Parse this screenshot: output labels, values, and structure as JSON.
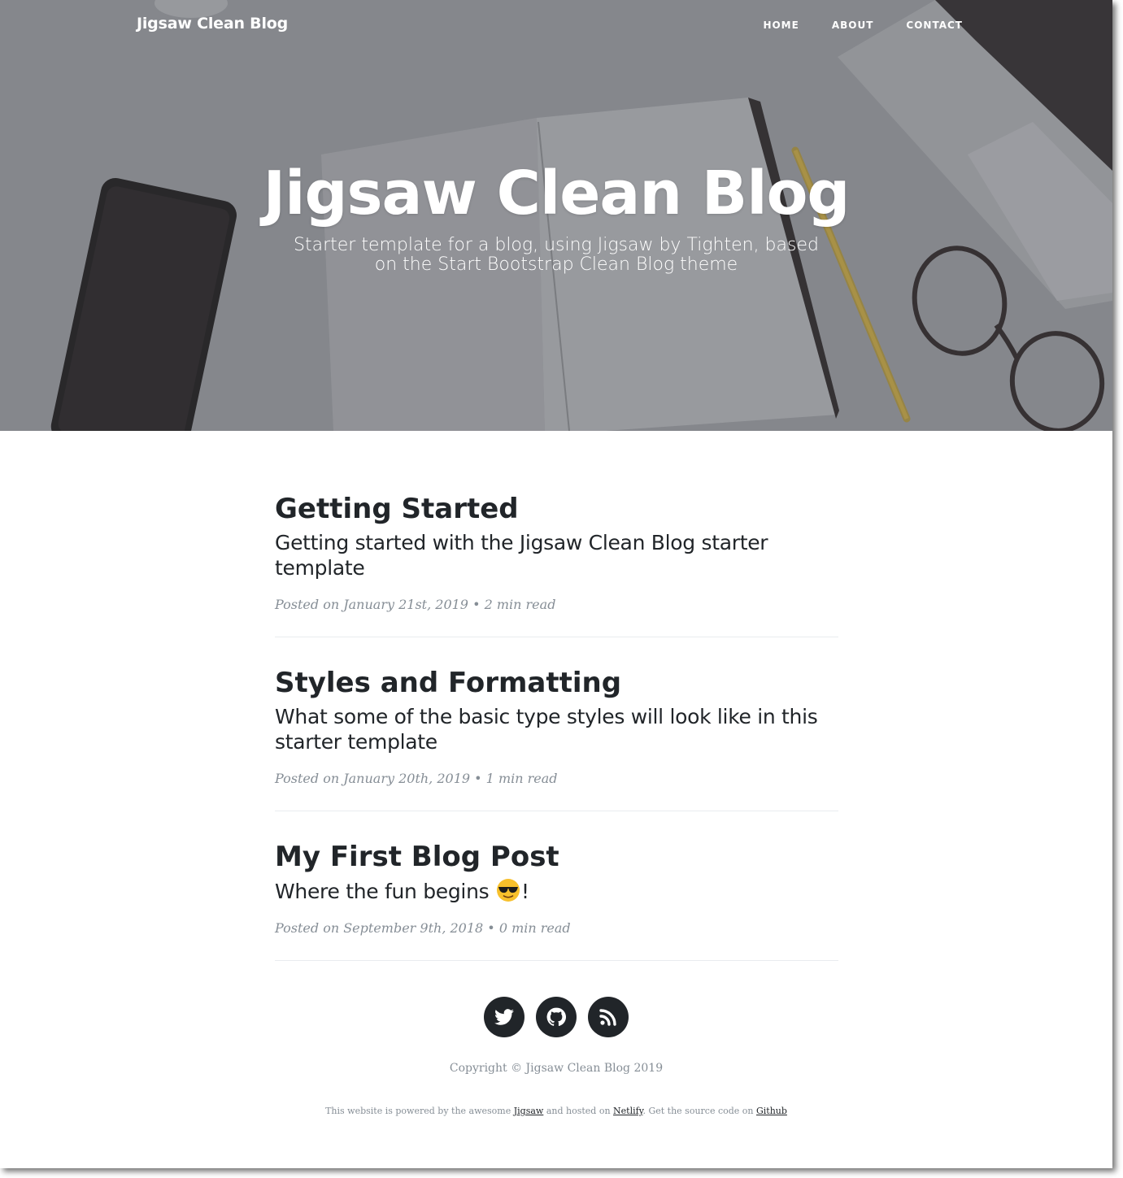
{
  "header": {
    "brand": "Jigsaw Clean Blog",
    "nav": [
      "HOME",
      "ABOUT",
      "CONTACT"
    ],
    "title": "Jigsaw Clean Blog",
    "subtitle": "Starter template for a blog, using Jigsaw by Tighten, based on the Start Bootstrap Clean Blog theme"
  },
  "posts": [
    {
      "title": "Getting Started",
      "subtitle": "Getting started with the Jigsaw Clean Blog starter template",
      "meta": "Posted on January 21st, 2019 • 2 min read"
    },
    {
      "title": "Styles and Formatting",
      "subtitle": "What some of the basic type styles will look like in this starter template",
      "meta": "Posted on January 20th, 2019 • 1 min read"
    },
    {
      "title": "My First Blog Post",
      "subtitle_before": "Where the fun begins ",
      "subtitle_after": "!",
      "emoji": "sunglasses-emoji",
      "meta": "Posted on September 9th, 2018 • 0 min read"
    }
  ],
  "footer": {
    "social_icons": [
      "twitter-icon",
      "github-icon",
      "rss-icon"
    ],
    "copyright": "Copyright © Jigsaw Clean Blog 2019",
    "powered_1": "This website is powered by the awesome ",
    "link_jigsaw": "Jigsaw",
    "powered_2": " and hosted on ",
    "link_netlify": "Netlify",
    "powered_3": ". Get the source code on ",
    "link_github": "Github"
  },
  "colors": {
    "text": "#212529",
    "muted": "#868e96",
    "divider": "#e9ecef",
    "hero_overlay": "#8a8d92"
  }
}
